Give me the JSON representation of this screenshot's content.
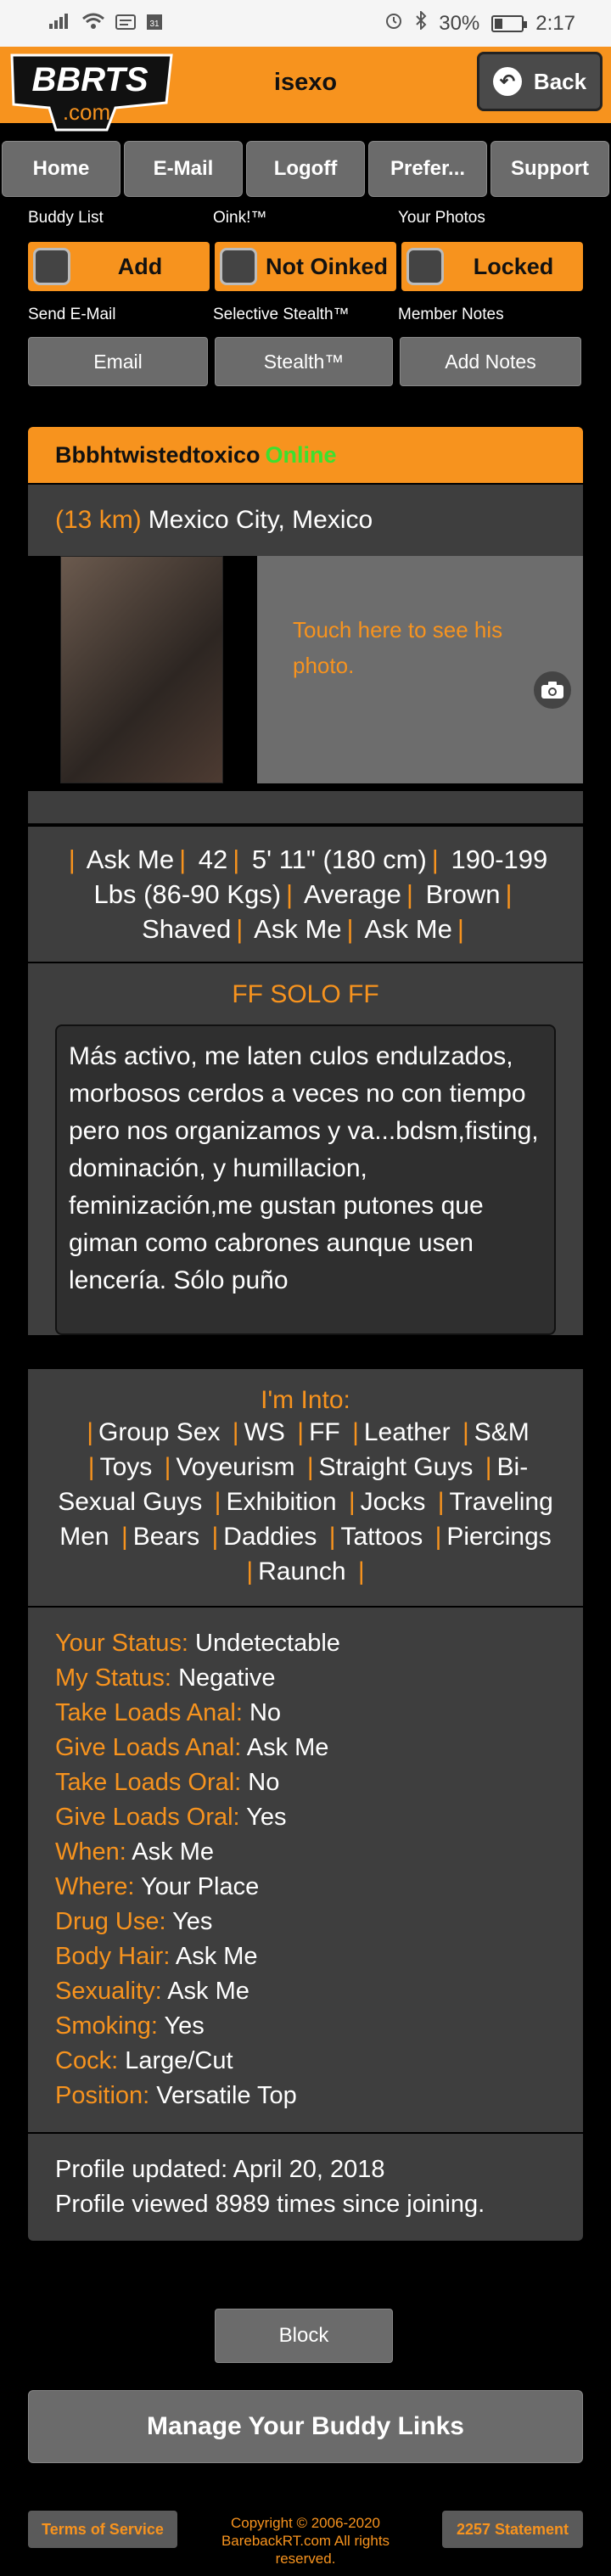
{
  "status_bar": {
    "battery": "30%",
    "time": "2:17",
    "battery_level": 0.3
  },
  "header": {
    "logo_text": "BBRTS",
    "logo_sub": ".com",
    "title": "isexo",
    "back_label": "Back"
  },
  "nav": [
    "Home",
    "E-Mail",
    "Logoff",
    "Prefer...",
    "Support"
  ],
  "actions": {
    "buddy_list_label": "Buddy List",
    "add_label": "Add",
    "oink_label": "Oink!™",
    "not_oinked_label": "Not Oinked",
    "photos_label": "Your Photos",
    "locked_label": "Locked",
    "send_email_label": "Send E-Mail",
    "email_label": "Email",
    "stealth_title": "Selective Stealth™",
    "stealth_label": "Stealth™",
    "notes_title": "Member Notes",
    "notes_label": "Add Notes"
  },
  "profile": {
    "username": "Bbbhtwistedtoxico",
    "online": "Online",
    "distance": "(13 km)",
    "location": "Mexico City, Mexico",
    "photo_prompt": "Touch here to see his photo.",
    "stats": [
      "Ask Me",
      "42",
      "5' 11\" (180 cm)",
      "190-199 Lbs (86-90 Kgs)",
      "Average",
      "Brown",
      "Shaved",
      "Ask Me",
      "Ask Me"
    ],
    "headline": "FF SOLO FF",
    "description": "Más activo, me laten culos endulzados, morbosos cerdos a veces no con tiempo pero nos organizamos y va...bdsm,fisting, dominación, y humillacion, feminización,me gustan putones que giman como cabrones aunque usen lencería. Sólo puño",
    "into_title": "I'm Into:",
    "into": [
      "Group Sex",
      "WS",
      "FF",
      "Leather",
      "S&M",
      "Toys",
      "Voyeurism",
      "Straight Guys",
      "Bi-Sexual Guys",
      "Exhibition",
      "Jocks",
      "Traveling Men",
      "Bears",
      "Daddies",
      "Tattoos",
      "Piercings",
      "Raunch"
    ],
    "details": [
      {
        "key": "Your Status:",
        "value": "Undetectable"
      },
      {
        "key": "My Status:",
        "value": "Negative"
      },
      {
        "key": "Take Loads Anal:",
        "value": "No"
      },
      {
        "key": "Give Loads Anal:",
        "value": "Ask Me"
      },
      {
        "key": "Take Loads Oral:",
        "value": "No"
      },
      {
        "key": "Give Loads Oral:",
        "value": "Yes"
      },
      {
        "key": "When:",
        "value": "Ask Me"
      },
      {
        "key": "Where:",
        "value": "Your Place"
      },
      {
        "key": "Drug Use:",
        "value": "Yes"
      },
      {
        "key": "Body Hair:",
        "value": "Ask Me"
      },
      {
        "key": "Sexuality:",
        "value": "Ask Me"
      },
      {
        "key": "Smoking:",
        "value": "Yes"
      },
      {
        "key": "Cock:",
        "value": "Large/Cut"
      },
      {
        "key": "Position:",
        "value": "Versatile Top"
      }
    ],
    "updated": "Profile updated: April 20, 2018",
    "viewed": "Profile viewed 8989 times since joining."
  },
  "block_label": "Block",
  "manage_label": "Manage Your Buddy Links",
  "footer": {
    "terms": "Terms of Service",
    "copyright": "Copyright © 2006-2020 BarebackRT.com All rights reserved.",
    "statement": "2257 Statement"
  },
  "colors": {
    "accent": "#f7931e",
    "online": "#3de02e",
    "panel": "#3e3e3e"
  }
}
